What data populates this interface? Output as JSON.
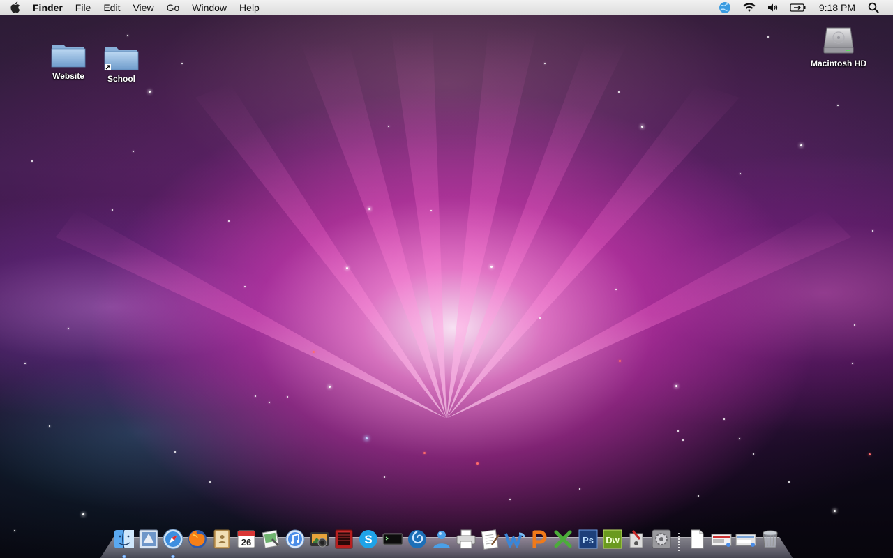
{
  "menubar": {
    "apple_icon": "apple-icon",
    "app_name": "Finder",
    "menus": [
      "File",
      "Edit",
      "View",
      "Go",
      "Window",
      "Help"
    ],
    "status_icons": [
      "spotlight-globe-icon",
      "wifi-icon",
      "volume-icon",
      "battery-icon"
    ],
    "clock": "9:18 PM",
    "search_icon": "spotlight-search-icon"
  },
  "desktop": {
    "icons": [
      {
        "label": "Website",
        "icon": "folder-icon"
      },
      {
        "label": "School",
        "icon": "folder-alias-icon"
      },
      {
        "label": "Macintosh HD",
        "icon": "hard-drive-icon"
      }
    ]
  },
  "dock": {
    "items": [
      {
        "name": "finder",
        "running": true
      },
      {
        "name": "mail",
        "running": false
      },
      {
        "name": "safari",
        "running": true
      },
      {
        "name": "firefox",
        "running": false
      },
      {
        "name": "address-book",
        "running": false
      },
      {
        "name": "ical",
        "running": false,
        "badge": "26"
      },
      {
        "name": "preview",
        "running": false
      },
      {
        "name": "itunes",
        "running": false
      },
      {
        "name": "iphoto",
        "running": false
      },
      {
        "name": "photo-booth",
        "running": false
      },
      {
        "name": "skype",
        "running": false,
        "badge": "S"
      },
      {
        "name": "terminal",
        "running": false
      },
      {
        "name": "cyberduck",
        "running": false
      },
      {
        "name": "ichat",
        "running": false
      },
      {
        "name": "printer",
        "running": false
      },
      {
        "name": "textedit",
        "running": false
      },
      {
        "name": "word",
        "running": false
      },
      {
        "name": "powerpoint",
        "running": false
      },
      {
        "name": "excel",
        "running": false
      },
      {
        "name": "photoshop",
        "running": false,
        "badge": "Ps"
      },
      {
        "name": "dreamweaver",
        "running": false,
        "badge": "Dw"
      },
      {
        "name": "script-editor",
        "running": false
      },
      {
        "name": "system-preferences",
        "running": false
      },
      {
        "name": "documents",
        "running": false
      },
      {
        "name": "downloads",
        "running": false
      },
      {
        "name": "stack",
        "running": false
      },
      {
        "name": "trash",
        "running": false
      }
    ]
  },
  "colors": {
    "menubar_top": "#f2f2f2",
    "menubar_bottom": "#dcdcdc",
    "wallpaper_core": "#ff8cdc",
    "folder_blue": "#8fb7dd"
  }
}
